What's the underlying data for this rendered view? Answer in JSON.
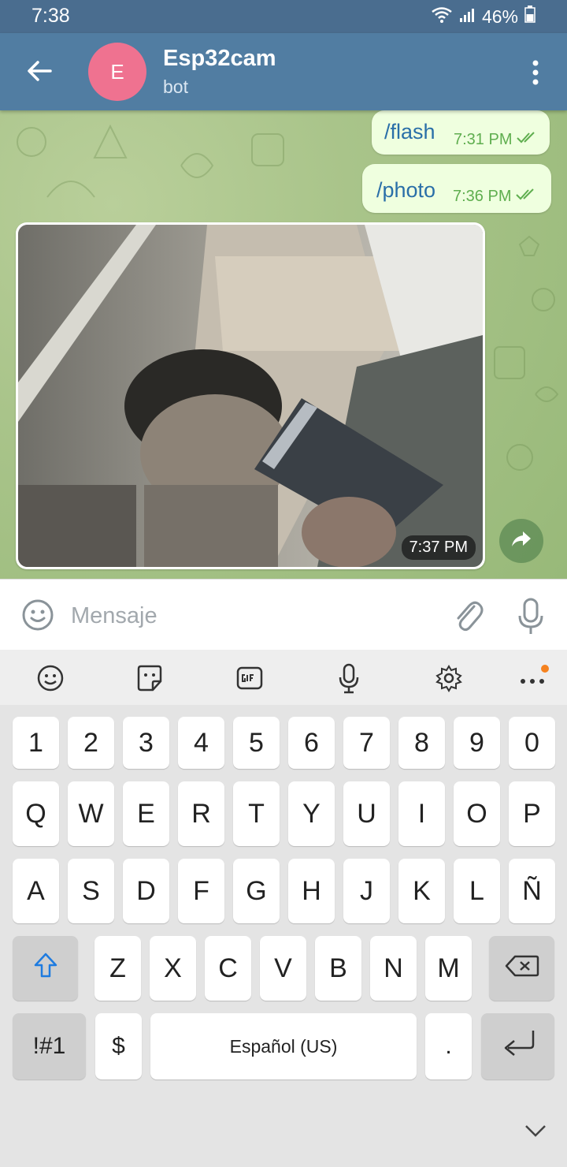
{
  "status_bar": {
    "time": "7:38",
    "battery": "46%"
  },
  "header": {
    "avatar_letter": "E",
    "title": "Esp32cam",
    "subtitle": "bot"
  },
  "messages": [
    {
      "text": "/flash",
      "time": "7:31 PM"
    },
    {
      "text": "/photo",
      "time": "7:36 PM"
    }
  ],
  "photo_message": {
    "time": "7:37 PM"
  },
  "composer": {
    "placeholder": "Mensaje"
  },
  "keyboard": {
    "row_numbers": [
      "1",
      "2",
      "3",
      "4",
      "5",
      "6",
      "7",
      "8",
      "9",
      "0"
    ],
    "row_top": [
      "Q",
      "W",
      "E",
      "R",
      "T",
      "Y",
      "U",
      "I",
      "O",
      "P"
    ],
    "row_middle": [
      "A",
      "S",
      "D",
      "F",
      "G",
      "H",
      "J",
      "K",
      "L",
      "Ñ"
    ],
    "row_bottom": [
      "Z",
      "X",
      "C",
      "V",
      "B",
      "N",
      "M"
    ],
    "symbols_label": "!#1",
    "dollar_label": "$",
    "space_label": "Español (US)",
    "period_label": "."
  },
  "colors": {
    "appbar": "#517da2",
    "avatar": "#ef7290",
    "bubble": "#efffdf",
    "accent_blue": "#2a6fa8"
  }
}
